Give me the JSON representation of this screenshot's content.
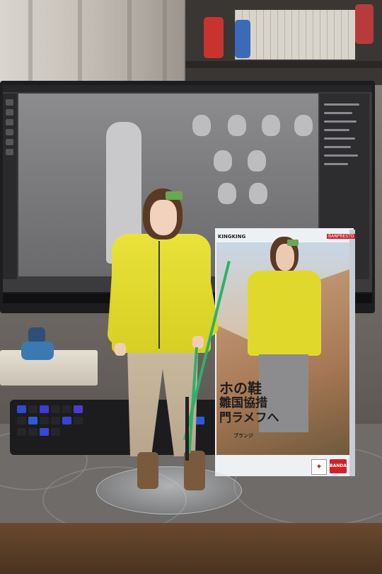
{
  "image": {
    "subject": "collectible-figure-on-desk",
    "colors": {
      "jacket": "#e4dc30",
      "pants": "#c2b296",
      "hair": "#5a3a24",
      "headband": "#6aa84f",
      "poles": "#2fb06a",
      "bandai_logo": "#d51f26"
    }
  },
  "box": {
    "brand_tl": "KINGKING",
    "brand_tr": "BANPRESTO",
    "title_line1": "ホの鞋",
    "title_line2": "雛国協措",
    "title_line3": "門ラメフへ",
    "subtitle": "ブランジ",
    "bandai_logo": "BANDAI"
  }
}
